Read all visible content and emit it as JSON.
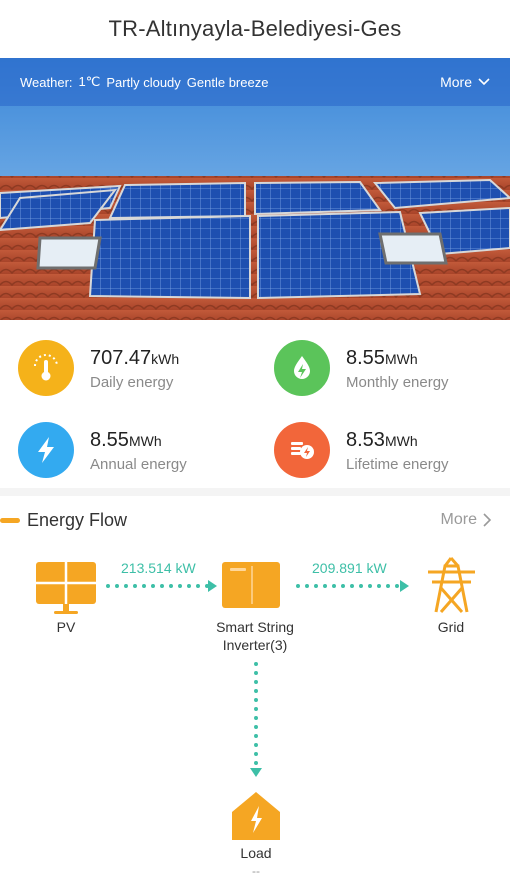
{
  "page": {
    "title": "TR-Altınyayla-Belediyesi-Ges"
  },
  "weather": {
    "label": "Weather:",
    "temp": "1℃",
    "condition": "Partly cloudy",
    "wind": "Gentle breeze",
    "more": "More"
  },
  "stats": [
    {
      "value": "707.47",
      "unit": "kWh",
      "label": "Daily energy",
      "icon": "thermometer-icon",
      "color": "#f5b21a"
    },
    {
      "value": "8.55",
      "unit": "MWh",
      "label": "Monthly energy",
      "icon": "drop-bolt-icon",
      "color": "#5bc45a"
    },
    {
      "value": "8.55",
      "unit": "MWh",
      "label": "Annual energy",
      "icon": "bolt-icon",
      "color": "#33aaf0"
    },
    {
      "value": "8.53",
      "unit": "MWh",
      "label": "Lifetime energy",
      "icon": "coins-icon",
      "color": "#f2663a"
    }
  ],
  "energy_flow": {
    "title": "Energy Flow",
    "more": "More",
    "pv_label": "PV",
    "inverter_label_1": "Smart String",
    "inverter_label_2": "Inverter(3)",
    "grid_label": "Grid",
    "load_label": "Load",
    "pv_power": "213.514 kW",
    "grid_power": "209.891 kW",
    "load_note": "--"
  },
  "colors": {
    "accent": "#f5a623",
    "flow": "#3dbfa7",
    "weather_bar": "#2864c8"
  }
}
